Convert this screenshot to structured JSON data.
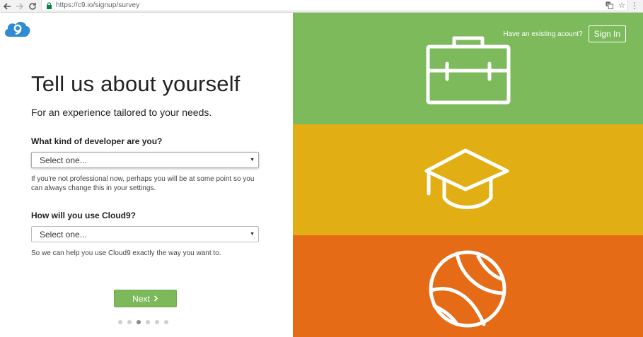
{
  "browser": {
    "url": "https://c9.io/signup/survey"
  },
  "logo": {
    "text": "9",
    "brand_color": "#2e8bd4"
  },
  "form": {
    "title": "Tell us about yourself",
    "subtitle": "For an experience tailored to your needs.",
    "question1": {
      "label": "What kind of developer are you?",
      "selected": "Select one...",
      "help": "If you're not professional now, perhaps you will be at some point so you can always change this in your settings."
    },
    "question2": {
      "label": "How will you use Cloud9?",
      "selected": "Select one...",
      "help": "So we can help you use Cloud9 exactly the way you want to."
    },
    "next_label": "Next",
    "progress": {
      "total_steps": 6,
      "current_step": 3
    }
  },
  "header": {
    "existing_account_text": "Have an existing acount?",
    "sign_in_label": "Sign In"
  },
  "panels": [
    {
      "icon": "briefcase-icon",
      "color": "#7cba5c"
    },
    {
      "icon": "graduation-cap-icon",
      "color": "#e1af14"
    },
    {
      "icon": "basketball-icon",
      "color": "#e56b16"
    }
  ],
  "colors": {
    "next_button": "#7cb95a"
  }
}
